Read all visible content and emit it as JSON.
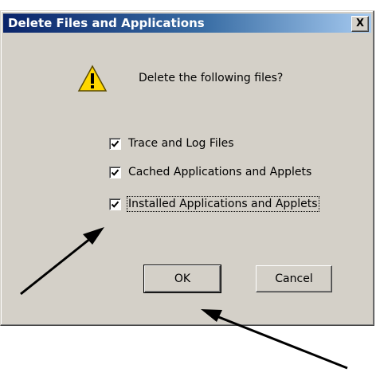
{
  "dialog": {
    "title": "Delete Files and Applications",
    "close_glyph": "X",
    "prompt": "Delete the following files?",
    "options": [
      {
        "label": "Trace and Log Files",
        "checked": true
      },
      {
        "label": "Cached Applications and Applets",
        "checked": true
      },
      {
        "label": "Installed Applications and Applets",
        "checked": true
      }
    ],
    "ok_label": "OK",
    "cancel_label": "Cancel"
  },
  "icons": {
    "warning": "warning-triangle-icon",
    "check": "checkmark-icon"
  },
  "colors": {
    "title_bar_start": "#0a246a",
    "title_bar_end": "#a6caf0",
    "dialog_face": "#d4d0c8",
    "warning_yellow": "#ffd700",
    "annotation_arrow": "#000000"
  }
}
